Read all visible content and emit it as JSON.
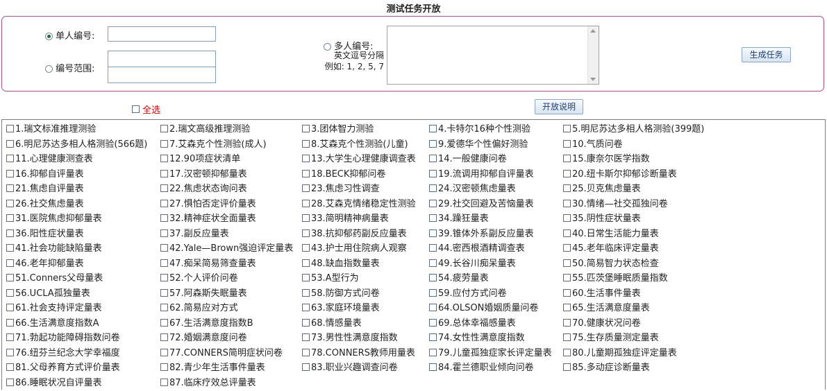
{
  "title": "测试任务开放",
  "form": {
    "single_label": "单人编号:",
    "range_label": "编号范围:",
    "multi_label": "多人编号:",
    "multi_hint_line1": "英文逗号分隔",
    "multi_hint_line2": "例如: 1, 2, 5, 7",
    "generate_label": "生成任务",
    "single_value": "",
    "range_from_value": "",
    "range_to_value": "",
    "multi_value": "",
    "selected_mode": "single"
  },
  "select_all_label": "全选",
  "open_help_label": "开放说明",
  "tests": [
    "1.瑞文标准推理测验",
    "2.瑞文高级推理测验",
    "3.团体智力测验",
    "4.卡特尔16种个性测验",
    "5.明尼苏达多相人格测验(399题)",
    "6.明尼苏达多相人格测验(566题)",
    "7.艾森克个性测验(成人)",
    "8.艾森克个性测验(儿童)",
    "9.爱德华个性偏好测验",
    "10.气质问卷",
    "11.心理健康测查表",
    "12.90项症状清单",
    "13.大学生心理健康调查表",
    "14.一般健康问卷",
    "15.康奈尔医学指数",
    "16.抑郁自评量表",
    "17.汉密顿抑郁量表",
    "18.BECK抑郁问卷",
    "19.流调用抑郁自评量表",
    "20.纽卡斯尔抑郁诊断量表",
    "21.焦虑自评量表",
    "22.焦虑状态询问表",
    "23.焦虑习性调查",
    "24.汉密顿焦虑量表",
    "25.贝克焦虑量表",
    "26.社交焦虑量表",
    "27.惧怕否定评价量表",
    "28.艾森克情绪稳定性测验",
    "29.社交回避及苦恼量表",
    "30.情绪—社交孤独问卷",
    "31.医院焦虑抑郁量表",
    "32.精神症状全面量表",
    "33.简明精神病量表",
    "34.躁狂量表",
    "35.阴性症状量表",
    "36.阳性症状量表",
    "37.副反应量表",
    "38.抗抑郁药副反应量表",
    "39.锥体外系副反应量表",
    "40.日常生活能力量表",
    "41.社会功能缺陷量表",
    "42.Yale—Brown强迫评定量表",
    "43.护士用住院病人观察",
    "44.密西根酒精调查表",
    "45.老年临床评定量表",
    "46.老年抑郁量表",
    "47.痴呆简易筛查量表",
    "48.缺血指数量表",
    "49.长谷川痴呆量表",
    "50.简易智力状态检查",
    "51.Conners父母量表",
    "52.个人评价问卷",
    "53.A型行为",
    "54.疲劳量表",
    "55.匹茨堡睡眠质量指数",
    "56.UCLA孤独量表",
    "57.阿森斯失眠量表",
    "58.防御方式问卷",
    "59.应付方式问卷",
    "60.生活事件量表",
    "61.社会支持评定量表",
    "62.简易应对方式",
    "63.家庭环境量表",
    "64.OLSON婚姻质量问卷",
    "65.生活满意度量表",
    "66.生活满意度指数A",
    "67.生活满意度指数B",
    "68.情感量表",
    "69.总体幸福感量表",
    "70.健康状况问卷",
    "71.勃起功能障碍指数问卷",
    "72.婚姻满意度问卷",
    "73.男性性满意度指数",
    "74.女性性满意度指数",
    "75.生存质量测定量表",
    "76.纽芬兰纪念大学幸福度",
    "77.CONNERS简明症状问卷",
    "78.CONNERS教师用量表",
    "79.儿童孤独症家长评定量表",
    "80.儿童期孤独症评定量表",
    "81.父母养育方式评价量表",
    "82.青少年生活事件量表",
    "83.职业兴趣调查问卷",
    "84.霍兰德职业倾向问卷",
    "85.多动症诊断量表",
    "86.睡眠状况自评量表",
    "87.临床疗效总评量表"
  ]
}
